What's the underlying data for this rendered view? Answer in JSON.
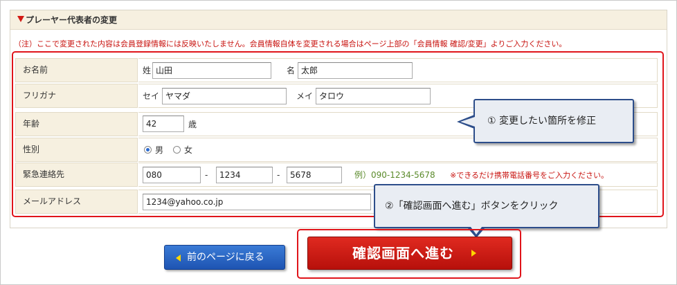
{
  "section": {
    "title": "プレーヤー代表者の変更",
    "notice": "（注）ここで変更された内容は会員登録情報には反映いたしません。会員情報自体を変更される場合はページ上部の「会員情報 確認/変更」よりご入力ください。"
  },
  "form": {
    "name": {
      "label": "お名前",
      "sei_label": "姓",
      "sei_value": "山田",
      "mei_label": "名",
      "mei_value": "太郎"
    },
    "furigana": {
      "label": "フリガナ",
      "sei_label": "セイ",
      "sei_value": "ヤマダ",
      "mei_label": "メイ",
      "mei_value": "タロウ"
    },
    "age": {
      "label": "年齢",
      "value": "42",
      "unit": "歳"
    },
    "gender": {
      "label": "性別",
      "options": [
        "男",
        "女"
      ],
      "selected": "男"
    },
    "emergency": {
      "label": "緊急連絡先",
      "part1": "080",
      "part2": "1234",
      "part3": "5678",
      "separator": "-",
      "example": "例）090-1234-5678",
      "note": "※できるだけ携帯電話番号をご入力ください。"
    },
    "email": {
      "label": "メールアドレス",
      "value": "1234@yahoo.co.jp"
    }
  },
  "callouts": {
    "step1": "① 変更したい箇所を修正",
    "step2": "②「確認画面へ進む」ボタンをクリック"
  },
  "buttons": {
    "back": "前のページに戻る",
    "confirm": "確認画面へ進む"
  },
  "colors": {
    "accent_red": "#e0141a",
    "label_bg": "#f6f0e0",
    "callout_border": "#2c4d8a",
    "back_button": "#2a66c4",
    "confirm_button": "#cc1a12"
  }
}
